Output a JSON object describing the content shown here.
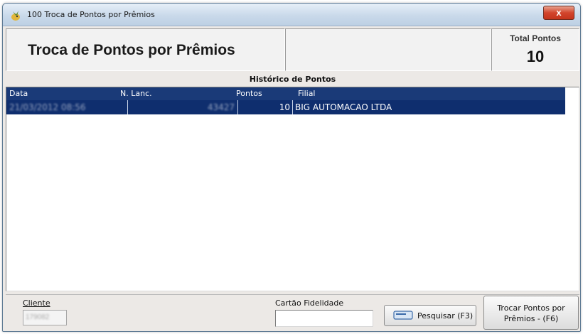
{
  "window": {
    "title": "100 Troca de Pontos por Prêmios",
    "close_glyph": "x"
  },
  "header": {
    "title": "Troca de Pontos por Prêmios",
    "total_label": "Total Pontos",
    "total_value": "10"
  },
  "grid": {
    "caption": "Histórico de Pontos",
    "columns": [
      "Data",
      "N. Lanc.",
      "Pontos",
      "Filial"
    ],
    "rows": [
      {
        "data": "21/03/2012 08:56",
        "n_lanc": "43427",
        "pontos": "10",
        "filial": "BIG AUTOMACAO LTDA"
      }
    ]
  },
  "footer": {
    "cliente_label": "Cliente",
    "cliente_value": "179082",
    "cartao_label": "Cartão Fidelidade",
    "cartao_value": "",
    "pesquisar_label": "Pesquisar (F3)",
    "trocar_line1": "Trocar Pontos por",
    "trocar_line2": "Prêmios - (F6)"
  },
  "colors": {
    "grid_header": "#1a3a78",
    "grid_selected_row": "#0f2e6e",
    "window_bg": "#ece9e6",
    "close_button": "#d2452c"
  },
  "icons": {
    "app": "bird-app-icon",
    "close": "close-icon",
    "search": "card-reader-icon"
  }
}
